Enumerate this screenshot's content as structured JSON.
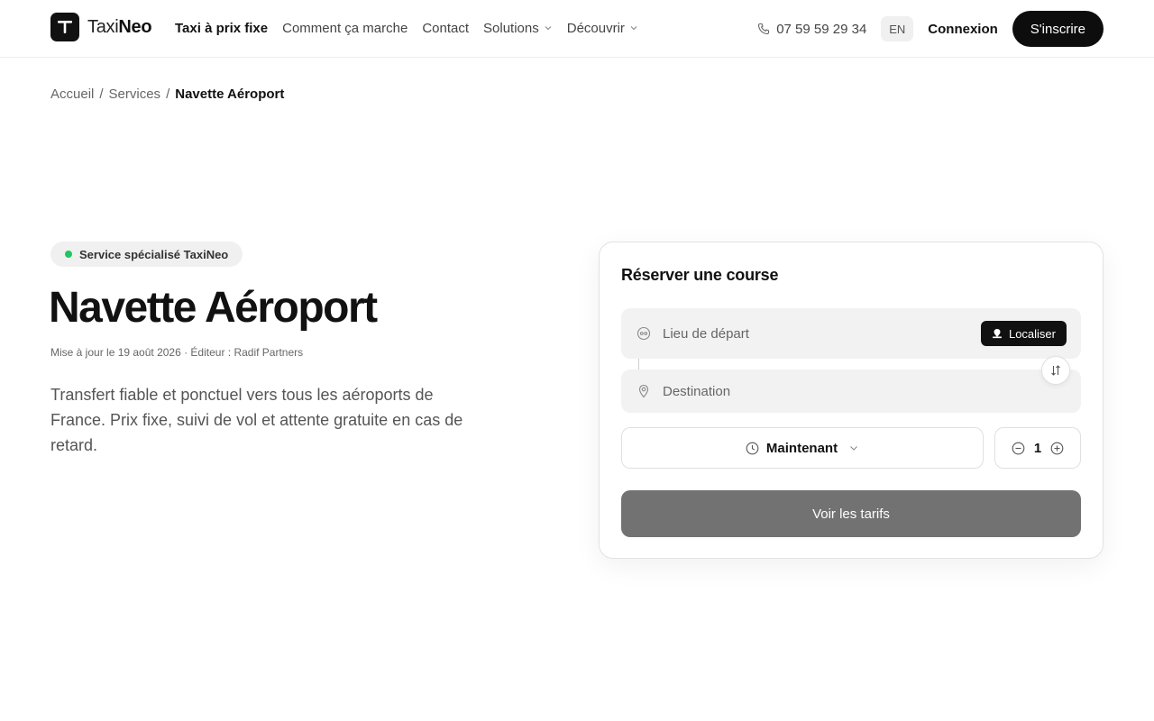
{
  "brand": {
    "light": "Taxi",
    "bold": "Neo"
  },
  "nav": {
    "items": [
      {
        "label": "Taxi à prix fixe",
        "active": true
      },
      {
        "label": "Comment ça marche"
      },
      {
        "label": "Contact"
      },
      {
        "label": "Solutions",
        "dropdown": true
      },
      {
        "label": "Découvrir",
        "dropdown": true
      }
    ]
  },
  "header": {
    "phone": "07 59 59 29 34",
    "lang": "EN",
    "login": "Connexion",
    "signup": "S'inscrire"
  },
  "breadcrumb": [
    {
      "label": "Accueil"
    },
    {
      "label": "Services"
    },
    {
      "label": "Navette Aéroport",
      "current": true
    }
  ],
  "hero": {
    "badge": "Service spécialisé TaxiNeo",
    "title": "Navette Aéroport",
    "meta": "Mise à jour le 19 août 2026 · Éditeur : Radif Partners",
    "description": "Transfert fiable et ponctuel vers tous les aéroports de France. Prix fixe, suivi de vol et attente gratuite en cas de retard."
  },
  "booking": {
    "title": "Réserver une course",
    "departure_placeholder": "Lieu de départ",
    "locate_label": "Localiser",
    "destination_placeholder": "Destination",
    "when_label": "Maintenant",
    "passengers": "1",
    "cta": "Voir les tarifs"
  },
  "colors": {
    "badge_dot": "#22c55e",
    "primary": "#0d0d0d",
    "cta_disabled": "#727272"
  }
}
